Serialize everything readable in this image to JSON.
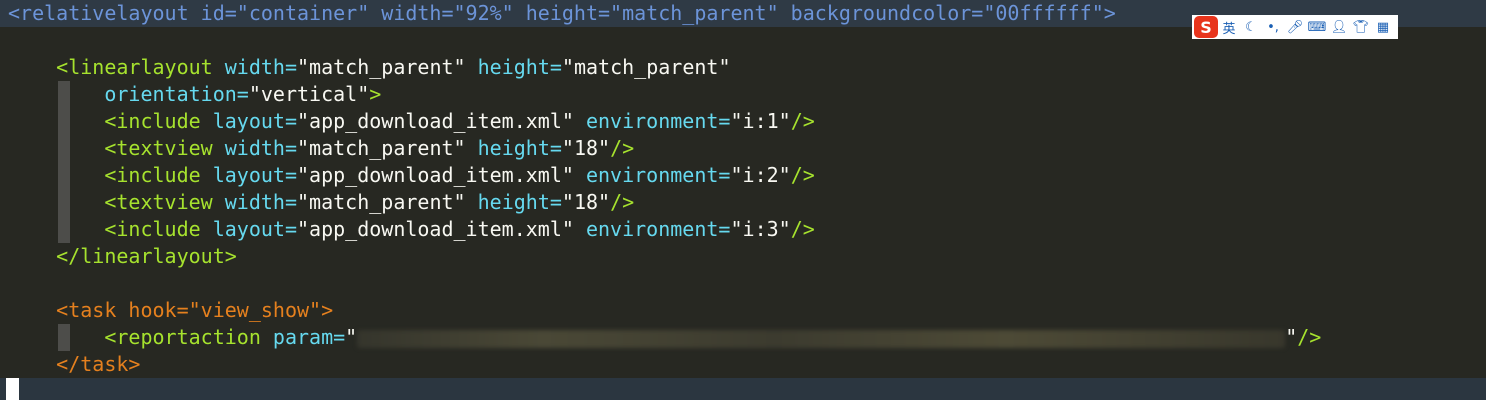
{
  "code_lines": [
    {
      "tokens": [
        {
          "t": "<relativelayout id=\"container\" width=\"92%\" height=\"match_parent\" backgroundcolor=\"00ffffff\">",
          "c": "blue"
        }
      ]
    },
    {
      "tokens": []
    },
    {
      "tokens": [
        {
          "t": "    "
        },
        {
          "t": "<linearlayout",
          "c": "green"
        },
        {
          "t": " width=",
          "c": "cyan"
        },
        {
          "t": "\"match_parent\"",
          "c": "white"
        },
        {
          "t": " height=",
          "c": "cyan"
        },
        {
          "t": "\"match_parent\"",
          "c": "white"
        }
      ]
    },
    {
      "tokens": [
        {
          "t": "        "
        },
        {
          "t": "orientation=",
          "c": "cyan"
        },
        {
          "t": "\"vertical\"",
          "c": "white"
        },
        {
          "t": ">",
          "c": "green"
        }
      ]
    },
    {
      "tokens": [
        {
          "t": "        "
        },
        {
          "t": "<include",
          "c": "green"
        },
        {
          "t": " layout=",
          "c": "cyan"
        },
        {
          "t": "\"app_download_item.xml\"",
          "c": "white"
        },
        {
          "t": " environment=",
          "c": "cyan"
        },
        {
          "t": "\"i:1\"",
          "c": "white"
        },
        {
          "t": "/>",
          "c": "green"
        }
      ]
    },
    {
      "tokens": [
        {
          "t": "        "
        },
        {
          "t": "<textview",
          "c": "green"
        },
        {
          "t": " width=",
          "c": "cyan"
        },
        {
          "t": "\"match_parent\"",
          "c": "white"
        },
        {
          "t": " height=",
          "c": "cyan"
        },
        {
          "t": "\"18\"",
          "c": "white"
        },
        {
          "t": "/>",
          "c": "green"
        }
      ]
    },
    {
      "tokens": [
        {
          "t": "        "
        },
        {
          "t": "<include",
          "c": "green"
        },
        {
          "t": " layout=",
          "c": "cyan"
        },
        {
          "t": "\"app_download_item.xml\"",
          "c": "white"
        },
        {
          "t": " environment=",
          "c": "cyan"
        },
        {
          "t": "\"i:2\"",
          "c": "white"
        },
        {
          "t": "/>",
          "c": "green"
        }
      ]
    },
    {
      "tokens": [
        {
          "t": "        "
        },
        {
          "t": "<textview",
          "c": "green"
        },
        {
          "t": " width=",
          "c": "cyan"
        },
        {
          "t": "\"match_parent\"",
          "c": "white"
        },
        {
          "t": " height=",
          "c": "cyan"
        },
        {
          "t": "\"18\"",
          "c": "white"
        },
        {
          "t": "/>",
          "c": "green"
        }
      ]
    },
    {
      "tokens": [
        {
          "t": "        "
        },
        {
          "t": "<include",
          "c": "green"
        },
        {
          "t": " layout=",
          "c": "cyan"
        },
        {
          "t": "\"app_download_item.xml\"",
          "c": "white"
        },
        {
          "t": " environment=",
          "c": "cyan"
        },
        {
          "t": "\"i:3\"",
          "c": "white"
        },
        {
          "t": "/>",
          "c": "green"
        }
      ]
    },
    {
      "tokens": [
        {
          "t": "    "
        },
        {
          "t": "</linearlayout>",
          "c": "green"
        }
      ]
    },
    {
      "tokens": []
    },
    {
      "tokens": [
        {
          "t": "    "
        },
        {
          "t": "<task hook=\"view_show\">",
          "c": "orange"
        }
      ]
    },
    {
      "tokens": [
        {
          "t": "        "
        },
        {
          "t": "<reportaction",
          "c": "green"
        },
        {
          "t": " param=",
          "c": "cyan"
        },
        {
          "t": "\"",
          "c": "white"
        },
        {
          "blur": true
        },
        {
          "t": "\"",
          "c": "white"
        },
        {
          "t": "/>",
          "c": "green"
        }
      ]
    },
    {
      "tokens": [
        {
          "t": "    "
        },
        {
          "t": "</task>",
          "c": "orange"
        }
      ]
    }
  ],
  "ime_toolbar": {
    "logo": "S",
    "lang_label": "英",
    "icons": [
      "moon-icon",
      "punctuation-icon",
      "microphone-icon",
      "keyboard-icon",
      "user-icon",
      "shirt-icon",
      "grid-icon"
    ]
  },
  "colors": {
    "background": "#272822",
    "tag_blue": "#6c94d9",
    "tag_orange": "#e5801e",
    "tag_green": "#a6e22e",
    "attr_cyan": "#66d9ef",
    "ime_logo": "#e8341c"
  }
}
